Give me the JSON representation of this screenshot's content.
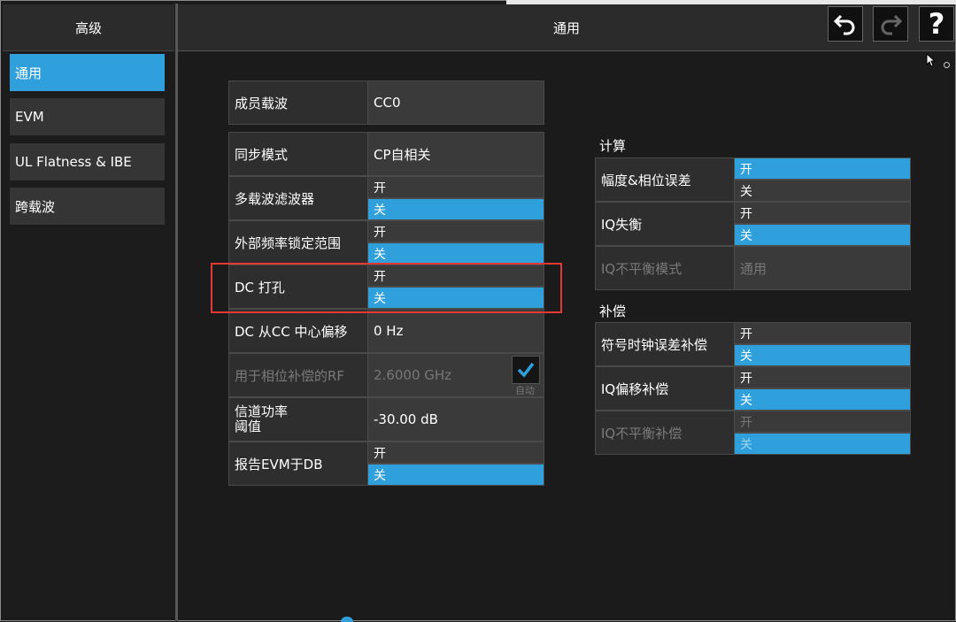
{
  "left_header": {
    "title": "高级"
  },
  "sidebar": {
    "items": [
      {
        "label": "通用",
        "active": true
      },
      {
        "label": "EVM",
        "active": false
      },
      {
        "label": "UL Flatness & IBE",
        "active": false
      },
      {
        "label": "跨载波",
        "active": false
      }
    ]
  },
  "header": {
    "title": "通用",
    "undo_icon": "undo-icon",
    "redo_icon": "redo-icon",
    "help_icon": "help-icon",
    "help_label": "?"
  },
  "main": {
    "component_carrier": {
      "label": "成员载波",
      "value": "CC0"
    },
    "sync_mode": {
      "label": "同步模式",
      "value": "CP自相关"
    },
    "multi_carrier_filter": {
      "label": "多载波滤波器",
      "on": "开",
      "off": "关",
      "selected": "off"
    },
    "ext_freq_lock": {
      "label": "外部频率锁定范围",
      "on": "开",
      "off": "关",
      "selected": "off"
    },
    "dc_punch": {
      "label": "DC 打孔",
      "on": "开",
      "off": "关",
      "selected": "off"
    },
    "dc_offset": {
      "label": "DC 从CC 中心偏移",
      "value": "0 Hz"
    },
    "phase_comp_rf": {
      "label": "用于相位补偿的RF",
      "value": "2.6000 GHz",
      "auto": "自动",
      "disabled": true
    },
    "channel_power_threshold": {
      "label_line1": "信道功率",
      "label_line2": "阈值",
      "value": "-30.00 dB"
    },
    "report_evm_db": {
      "label": "报告EVM于DB",
      "on": "开",
      "off": "关",
      "selected": "off"
    }
  },
  "calc": {
    "title": "计算",
    "mag_phase_error": {
      "label": "幅度&相位误差",
      "on": "开",
      "off": "关",
      "selected": "on"
    },
    "iq_imbalance": {
      "label": "IQ失衡",
      "on": "开",
      "off": "关",
      "selected": "off"
    },
    "iq_imbalance_mode": {
      "label": "IQ不平衡模式",
      "value": "通用",
      "disabled": true
    }
  },
  "compensation": {
    "title": "补偿",
    "symbol_clock_error": {
      "label": "符号时钟误差补偿",
      "on": "开",
      "off": "关",
      "selected": "off"
    },
    "iq_offset": {
      "label": "IQ偏移补偿",
      "on": "开",
      "off": "关",
      "selected": "off"
    },
    "iq_imbalance_comp": {
      "label": "IQ不平衡补偿",
      "on": "开",
      "off": "关",
      "selected": "off",
      "disabled": true
    }
  },
  "colors": {
    "accent": "#2fa0dc",
    "highlight": "#e53935",
    "background": "#1b1b1b"
  }
}
